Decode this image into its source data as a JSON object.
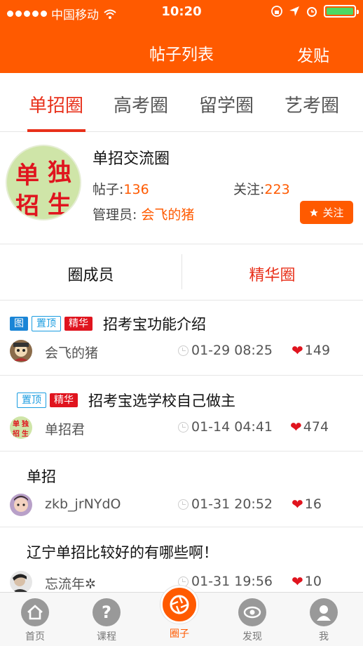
{
  "status_bar": {
    "carrier": "中国移动",
    "time": "10:20"
  },
  "nav": {
    "title": "帖子列表",
    "action": "发贴"
  },
  "tabs": [
    {
      "label": "单招圈",
      "active": true
    },
    {
      "label": "高考圈",
      "active": false
    },
    {
      "label": "留学圈",
      "active": false
    },
    {
      "label": "艺考圈",
      "active": false
    }
  ],
  "circle": {
    "avatar_text": [
      "单",
      "独",
      "招",
      "生"
    ],
    "name": "单招交流圈",
    "posts_label": "帖子:",
    "posts_count": "136",
    "follows_label": "关注:",
    "follows_count": "223",
    "admin_label": "管理员:",
    "admin_name": "会飞的猪",
    "follow_button": "关注"
  },
  "segment": {
    "left": "圈成员",
    "right": "精华圈"
  },
  "posts": [
    {
      "tags": [
        "图",
        "置顶",
        "精华"
      ],
      "title": "招考宝功能介绍",
      "author": "会飞的猪",
      "time": "01-29 08:25",
      "likes": "149"
    },
    {
      "tags": [
        "置顶",
        "精华"
      ],
      "title": "招考宝选学校自己做主",
      "author": "单招君",
      "avatar_text": [
        "单",
        "独",
        "招",
        "生"
      ],
      "time": "01-14 04:41",
      "likes": "474"
    },
    {
      "tags": [],
      "title": "单招",
      "author": "zkb_jrNYdO",
      "time": "01-31 20:52",
      "likes": "16"
    },
    {
      "tags": [],
      "title": "辽宁单招比较好的有哪些啊！",
      "author": "忘流年✲",
      "time": "01-31 19:56",
      "likes": "10"
    }
  ],
  "tabbar": [
    {
      "label": "首页",
      "icon": "home-icon"
    },
    {
      "label": "课程",
      "icon": "question-icon"
    },
    {
      "label": "圈子",
      "icon": "camera-aperture-icon",
      "active": true
    },
    {
      "label": "发现",
      "icon": "eye-icon"
    },
    {
      "label": "我",
      "icon": "user-icon"
    }
  ],
  "colors": {
    "brand": "#FF5A00",
    "active_red": "#E8301A",
    "tag_blue": "#1A85D6",
    "tag_red": "#E0141E"
  }
}
